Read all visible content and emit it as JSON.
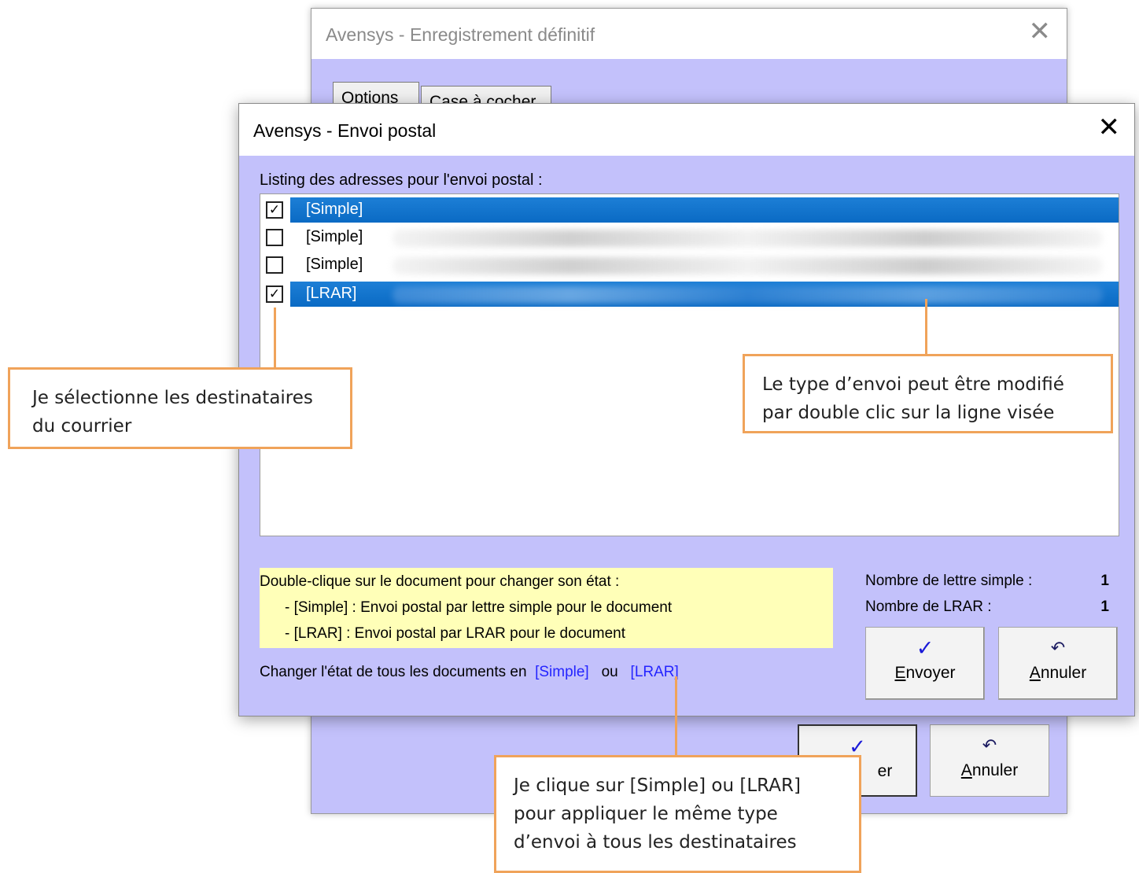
{
  "back_window": {
    "title": "Avensys - Enregistrement définitif",
    "tabs": [
      "Options",
      "Case à cocher"
    ],
    "send_fragment": "er",
    "cancel_label_pre": "",
    "cancel_label_u": "A",
    "cancel_label_rest": "nnuler"
  },
  "dialog": {
    "title": "Avensys - Envoi postal",
    "list_label": "Listing des adresses pour l'envoi postal :",
    "rows": [
      {
        "checked": true,
        "selected": true,
        "label": "[Simple]"
      },
      {
        "checked": false,
        "selected": false,
        "label": "[Simple]"
      },
      {
        "checked": false,
        "selected": false,
        "label": "[Simple]"
      },
      {
        "checked": true,
        "selected": true,
        "label": "[LRAR]"
      }
    ],
    "info": {
      "line1": "Double-clique sur le document pour changer son état :",
      "line2": "- [Simple] : Envoi postal par lettre simple pour le document",
      "line3": "- [LRAR] : Envoi postal par LRAR pour le document"
    },
    "change_all": {
      "prefix": "Changer l'état de tous les documents en",
      "simple_link": "[Simple]",
      "or": "ou",
      "lrar_link": "[LRAR]"
    },
    "counts": {
      "simple_label": "Nombre de lettre simple :",
      "simple_value": "1",
      "lrar_label": "Nombre de LRAR :",
      "lrar_value": "1"
    },
    "buttons": {
      "send_u": "E",
      "send_rest": "nvoyer",
      "cancel_u": "A",
      "cancel_rest": "nnuler"
    }
  },
  "callouts": {
    "select_recipients": [
      "Je sélectionne les destinataires",
      "du courrier"
    ],
    "double_click": [
      "Le type d’envoi peut être modifié",
      "par double clic sur la ligne visée"
    ],
    "apply_all": [
      "Je clique sur [Simple] ou [LRAR]",
      "pour appliquer le même type",
      "d’envoi à tous les destinataires"
    ]
  }
}
